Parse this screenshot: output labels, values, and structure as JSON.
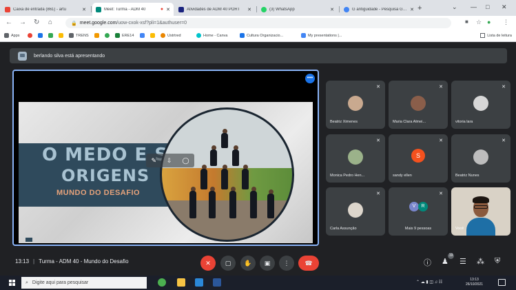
{
  "browser": {
    "tabs": [
      {
        "title": "Caixa de entrada (861) - artu",
        "active": false,
        "favicon_color": "#ea4335"
      },
      {
        "title": "Meet: Turma - ADM 40",
        "active": true,
        "favicon_color": "#00897b"
      },
      {
        "title": "Atividades de ADM 40 PORT",
        "active": false,
        "favicon_color": "#1a237e"
      },
      {
        "title": "(3) WhatsApp",
        "active": false,
        "favicon_color": "#25d366"
      },
      {
        "title": "G antiguidade - Pesquisa Goo",
        "active": false,
        "favicon_color": "#4285f4"
      }
    ],
    "url_host": "meet.google.com",
    "url_path": "/uow-cxok-xsf?pli=1&authuser=0",
    "bookmarks": [
      {
        "label": "Apps",
        "color": "#5f6368"
      },
      {
        "label": "",
        "color": "#ea4335"
      },
      {
        "label": "",
        "color": "#1a73e8"
      },
      {
        "label": "",
        "color": "#34a853"
      },
      {
        "label": "",
        "color": "#fbbc04"
      },
      {
        "label": "TRENS",
        "color": "#5f6368"
      },
      {
        "label": "",
        "color": "#f29900"
      },
      {
        "label": "",
        "color": "#34a853"
      },
      {
        "label": "ERE14",
        "color": "#188038"
      },
      {
        "label": "",
        "color": "#4285f4"
      },
      {
        "label": "",
        "color": "#fbbc04"
      },
      {
        "label": "Ustrtred",
        "color": "#ea8600"
      },
      {
        "label": "Home - Canva",
        "color": "#00c4cc"
      },
      {
        "label": "Cultura Organizacio...",
        "color": "#1a73e8"
      },
      {
        "label": "My presentations |...",
        "color": "#4285f4"
      }
    ],
    "reading_list": "Lista de leitura"
  },
  "meet": {
    "presenting_text": "berlando silva está apresentando",
    "slide": {
      "title_line1": "O MEDO E SUAS",
      "title_line2": "ORIGENS",
      "subtitle": "MUNDO DO DESAFIO"
    },
    "participants": [
      {
        "name": "Beatriz Ximenes",
        "avatar_color": "#c9a98f"
      },
      {
        "name": "Maria Clara Almei...",
        "avatar_color": "#8a5e4a"
      },
      {
        "name": "vitoria lara",
        "avatar_color": "#d7d7d7"
      },
      {
        "name": "Monica Pedro Hen...",
        "avatar_color": "#9bb28a"
      },
      {
        "name": "sandy ellen",
        "avatar_letter": "S",
        "avatar_color": "#f4511e"
      },
      {
        "name": "Beatriz Nunes",
        "avatar_color": "#bdbdbd"
      },
      {
        "name": "Carla Assunção",
        "avatar_color": "#ddd6cc"
      },
      {
        "name": "Mais 9 pessoas",
        "group": [
          "V",
          "R"
        ],
        "group_colors": [
          "#7986cb",
          "#00897b"
        ]
      },
      {
        "name": "Você",
        "self_video": true
      }
    ],
    "time": "13:13",
    "meeting_title": "Turma - ADM 40 - Mundo do Desafio",
    "participant_badge": "19"
  },
  "taskbar": {
    "search_placeholder": "Digite aqui para pesquisar",
    "time": "13:13",
    "date": "26/10/2021"
  }
}
